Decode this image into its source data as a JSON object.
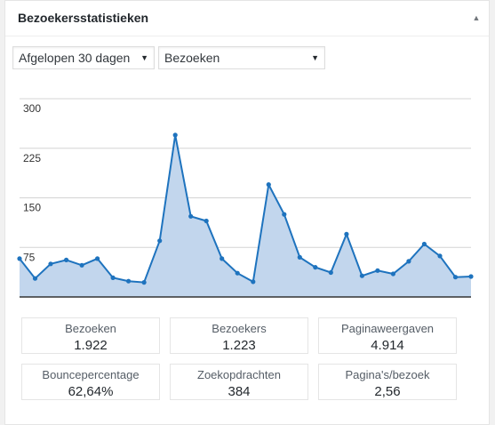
{
  "widget": {
    "title": "Bezoekersstatistieken",
    "collapse_icon": "triangle-up-icon"
  },
  "filters": {
    "period": "Afgelopen 30 dagen",
    "metric": "Bezoeken",
    "dropdown_icon": "triangle-down-icon"
  },
  "chart_data": {
    "type": "area",
    "title": "",
    "xlabel": "",
    "ylabel": "",
    "ylim": [
      0,
      300
    ],
    "yticks": [
      "300",
      "225",
      "150",
      "75"
    ],
    "grid": true,
    "series": [
      {
        "color": "#1e73be",
        "fill": "#c2d6ed",
        "values": [
          58,
          28,
          50,
          56,
          48,
          58,
          29,
          24,
          22,
          85,
          245,
          122,
          115,
          58,
          36,
          23,
          170,
          125,
          60,
          45,
          37,
          95,
          32,
          40,
          35,
          54,
          80,
          62,
          30,
          31
        ]
      }
    ]
  },
  "stats": [
    {
      "label": "Bezoeken",
      "value": "1.922"
    },
    {
      "label": "Bezoekers",
      "value": "1.223"
    },
    {
      "label": "Paginaweergaven",
      "value": "4.914"
    },
    {
      "label": "Bouncepercentage",
      "value": "62,64%"
    },
    {
      "label": "Zoekopdrachten",
      "value": "384"
    },
    {
      "label": "Pagina's/bezoek",
      "value": "2,56"
    }
  ]
}
